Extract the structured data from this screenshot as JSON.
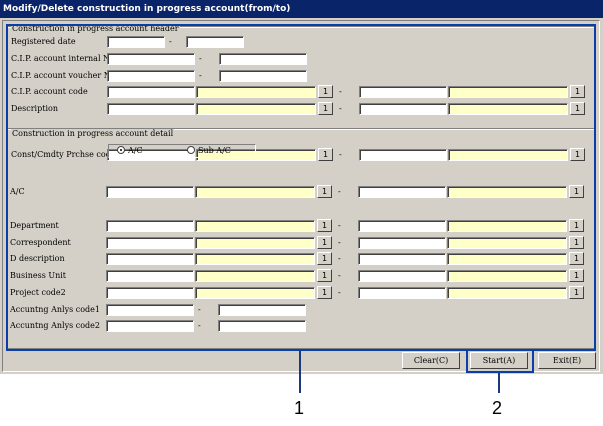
{
  "window": {
    "title": "Modify/Delete construction in progress account(from/to)"
  },
  "header_group": {
    "title": "Construction in progress account header",
    "registered_date": "Registered date",
    "internal_no": "C.I.P. account internal No.",
    "voucher_no": "C.I.P. account voucher No.",
    "account_code": "C.I.P. account code",
    "description": "Description"
  },
  "detail_group": {
    "title": "Construction in progress account detail",
    "purchase_code": "Const/Cmdty Prchse code",
    "radio_ac": "A/C",
    "radio_sub_ac": "Sub A/C",
    "ac": "A/C",
    "department": "Department",
    "correspondent": "Correspondent",
    "d_description": "D description",
    "business_unit": "Business Unit",
    "project_code2": "Project code2",
    "analysis_code1": "Accuntng Anlys code1",
    "analysis_code2": "Accuntng Anlys code2"
  },
  "common": {
    "range_dash": "-",
    "lookup_btn": "1"
  },
  "buttons": {
    "clear": "Clear(C)",
    "start": "Start(A)",
    "exit": "Exit(E)"
  },
  "callouts": {
    "one": "1",
    "two": "2"
  }
}
